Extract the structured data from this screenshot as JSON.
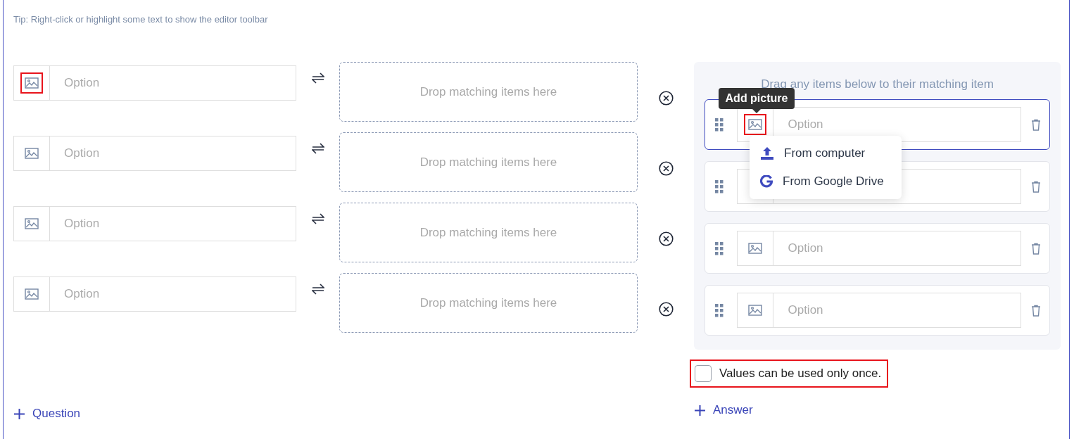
{
  "tip": "Tip: Right-click or highlight some text to show the editor toolbar",
  "questions": [
    {
      "placeholder": "Option",
      "image_highlighted": true,
      "drop_text": "Drop matching items here"
    },
    {
      "placeholder": "Option",
      "image_highlighted": false,
      "drop_text": "Drop matching items here"
    },
    {
      "placeholder": "Option",
      "image_highlighted": false,
      "drop_text": "Drop matching items here"
    },
    {
      "placeholder": "Option",
      "image_highlighted": false,
      "drop_text": "Drop matching items here"
    }
  ],
  "add_question": "Question",
  "answers_panel": {
    "heading": "Drag any items below to their matching item",
    "answers": [
      {
        "placeholder": "Option",
        "focused": true,
        "image_highlighted": true,
        "tooltip": "Add picture",
        "menu": [
          {
            "kind": "upload",
            "label": "From computer"
          },
          {
            "kind": "google",
            "label": "From Google Drive"
          }
        ]
      },
      {
        "focused": false,
        "image_highlighted": false,
        "covered": true
      },
      {
        "placeholder": "Option",
        "focused": false,
        "image_highlighted": false
      },
      {
        "placeholder": "Option",
        "focused": false,
        "image_highlighted": false
      }
    ]
  },
  "once_option": {
    "label": "Values can be used only once.",
    "checked": false,
    "highlighted": true
  },
  "add_answer": "Answer"
}
